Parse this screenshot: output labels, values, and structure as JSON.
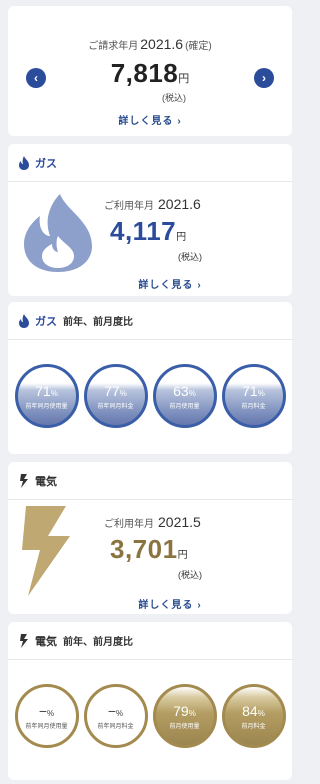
{
  "billing": {
    "period_label": "ご請求年月",
    "period_value": "2021.6",
    "period_status": "(確定)",
    "amount": "7,818",
    "currency": "円",
    "tax_note": "(税込)",
    "detail_link": "詳しく見る",
    "prev_icon": "chevron-left-icon",
    "next_icon": "chevron-right-icon"
  },
  "gas": {
    "title": "ガス",
    "period_label": "ご利用年月",
    "period_value": "2021.6",
    "amount": "4,117",
    "currency": "円",
    "tax_note": "(税込)",
    "detail_link": "詳しく見る",
    "icon": "flame-icon",
    "accent": "#2b4b9b"
  },
  "gas_comparison": {
    "title": "ガス",
    "subtitle": "前年、前月度比",
    "items": [
      {
        "percent": "71",
        "unit": "%",
        "label": "前年同月使用量",
        "level": 0.71
      },
      {
        "percent": "77",
        "unit": "%",
        "label": "前年同月料金",
        "level": 0.77
      },
      {
        "percent": "63",
        "unit": "%",
        "label": "前月使用量",
        "level": 0.63
      },
      {
        "percent": "71",
        "unit": "%",
        "label": "前月料金",
        "level": 0.71
      }
    ]
  },
  "electricity": {
    "title": "電気",
    "period_label": "ご利用年月",
    "period_value": "2021.5",
    "amount": "3,701",
    "currency": "円",
    "tax_note": "(税込)",
    "detail_link": "詳しく見る",
    "icon": "lightning-bolt-icon",
    "accent": "#a38a4e"
  },
  "electricity_comparison": {
    "title": "電気",
    "subtitle": "前年、前月度比",
    "items": [
      {
        "percent": "−",
        "unit": "%",
        "label": "前年同月使用量"
      },
      {
        "percent": "−",
        "unit": "%",
        "label": "前年同月料金"
      },
      {
        "percent": "79",
        "unit": "%",
        "label": "前月使用量",
        "level": 0.79
      },
      {
        "percent": "84",
        "unit": "%",
        "label": "前月料金",
        "level": 0.84
      }
    ]
  }
}
